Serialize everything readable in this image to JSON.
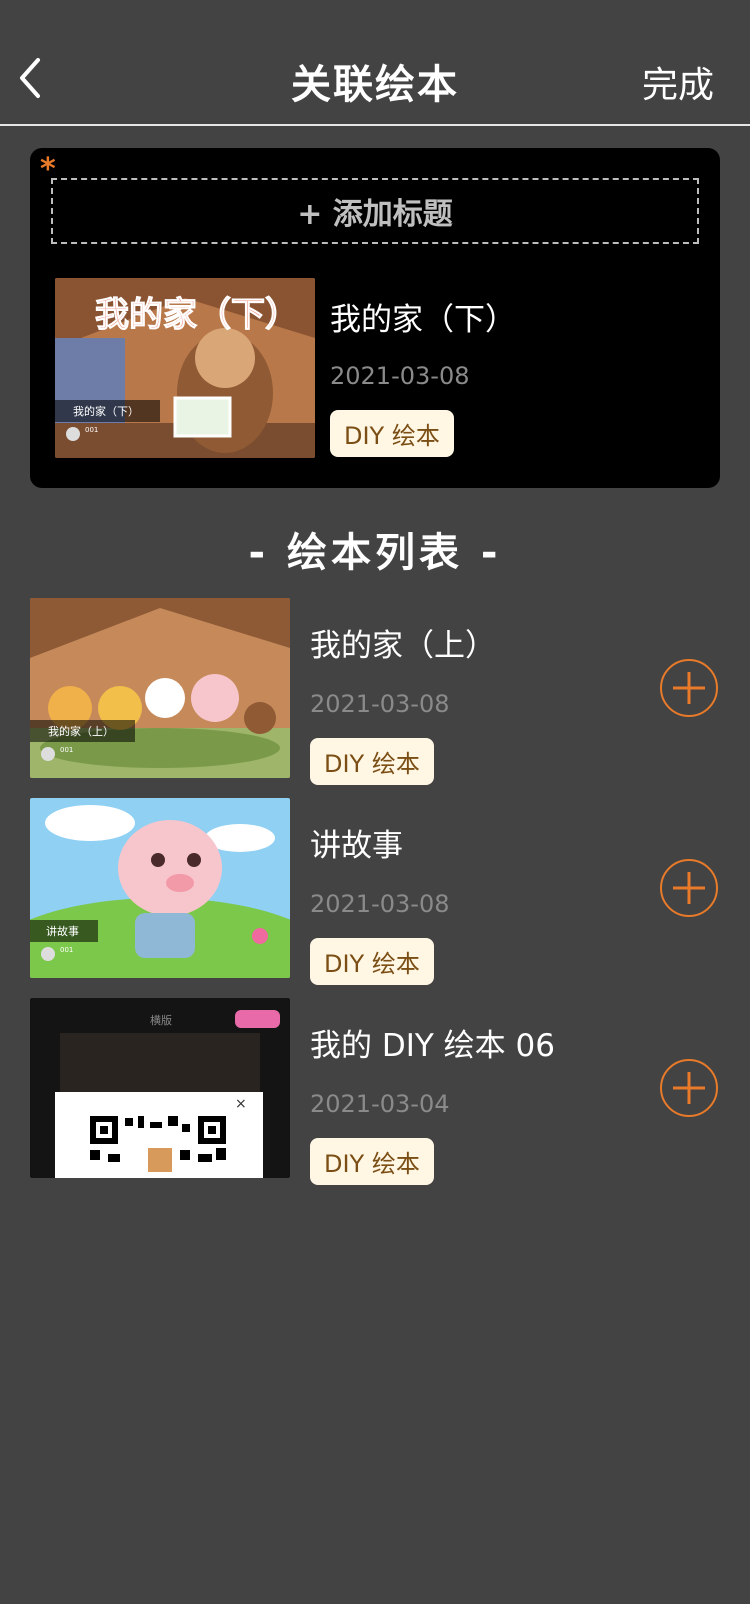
{
  "nav": {
    "title": "关联绘本",
    "done_label": "完成"
  },
  "selected": {
    "add_title_label": "+ 添加标题",
    "required_mark": "*",
    "book": {
      "title": "我的家（下）",
      "date": "2021-03-08",
      "badge": "DIY 绘本",
      "cover_text": "我的家（下）",
      "cover_caption": "我的家（下）",
      "cover_user": "001"
    }
  },
  "list_title": "-  绘本列表  -",
  "books": [
    {
      "title": "我的家（上）",
      "date": "2021-03-08",
      "badge": "DIY 绘本",
      "cover_caption": "我的家（上）",
      "cover_user": "001"
    },
    {
      "title": "讲故事",
      "date": "2021-03-08",
      "badge": "DIY 绘本",
      "cover_caption": "讲故事",
      "cover_user": "001"
    },
    {
      "title": "我的 DIY 绘本 06",
      "date": "2021-03-04",
      "badge": "DIY 绘本",
      "cover_caption": "横版",
      "cover_user": ""
    }
  ],
  "colors": {
    "accent": "#e87a2a",
    "background": "#434343",
    "badge_bg": "#fff6e3",
    "badge_text": "#7a4e14"
  }
}
